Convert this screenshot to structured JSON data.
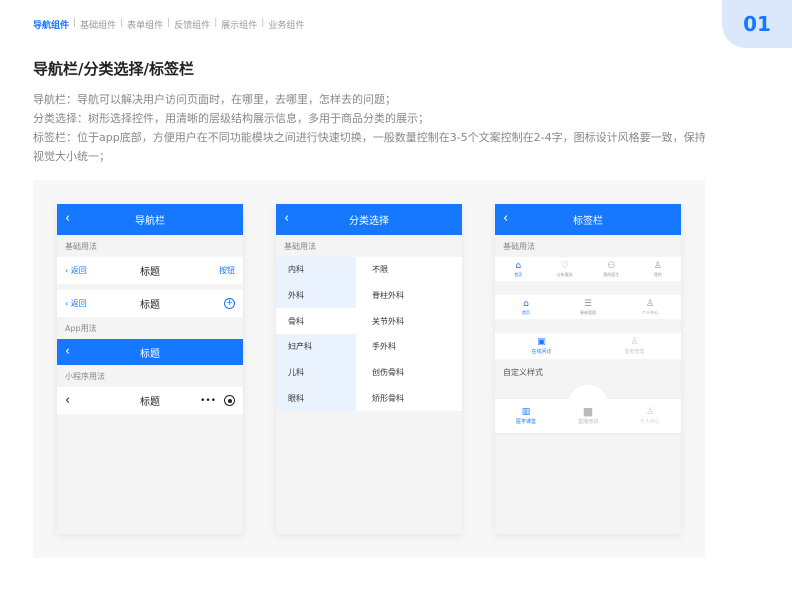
{
  "breadcrumb": {
    "items": [
      "导航组件",
      "基础组件",
      "表单组件",
      "反馈组件",
      "展示组件",
      "业务组件"
    ],
    "separator": "|"
  },
  "page_number": "01",
  "title": "导航栏/分类选择/标签栏",
  "description": [
    "导航栏：导航可以解决用户访问页面时，在哪里，去哪里，怎样去的问题；",
    "分类选择：树形选择控件，用清晰的层级结构展示信息，多用于商品分类的展示；",
    "标签栏：位于app底部，方便用户在不同功能模块之间进行快速切换，一般数量控制在3-5个文案控制在2-4字，图标设计风格要一致，保持视觉大小统一；"
  ],
  "phone1": {
    "header": "导航栏",
    "section_basic": "基础用法",
    "row1": {
      "back": "‹ 返回",
      "title": "标题",
      "action": "按钮"
    },
    "row2": {
      "back": "‹ 返回",
      "title": "标题",
      "plus": "+"
    },
    "section_app": "App用法",
    "app_bar_title": "标题",
    "section_mini": "小程序用法",
    "mini_row": {
      "title": "标题",
      "more": "•••"
    }
  },
  "phone2": {
    "header": "分类选择",
    "section_basic": "基础用法",
    "categories": [
      "内科",
      "外科",
      "骨科",
      "妇产科",
      "儿科",
      "眼科"
    ],
    "selected_index": 2,
    "subcategories": [
      "不限",
      "脊柱外科",
      "关节外科",
      "手外科",
      "创伤骨科",
      "矫形骨科"
    ]
  },
  "phone3": {
    "header": "标签栏",
    "section_basic": "基础用法",
    "tabbar1": [
      "首页",
      "分析服务",
      "我的医生",
      "我的"
    ],
    "tabbar2": [
      "首页",
      "患者管理",
      "个人中心"
    ],
    "tabbar3": [
      "在线问诊",
      "患者管理"
    ],
    "section_custom": "自定义样式",
    "tabbar_custom": [
      "医学课堂",
      "直播培训",
      "个人中心"
    ]
  },
  "colors": {
    "accent": "#1677ff",
    "tint": "#eaf2fe",
    "page_no_bg": "#dbe8fb"
  }
}
